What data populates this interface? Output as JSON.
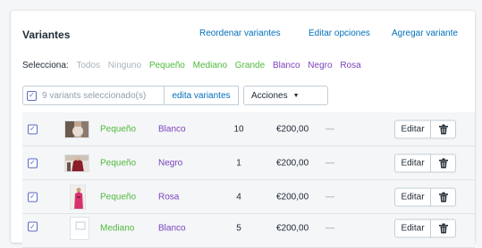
{
  "header": {
    "title": "Variantes",
    "reorder_link": "Reordenar variantes",
    "edit_options_link": "Editar opciones",
    "add_variant_link": "Agregar variante"
  },
  "select_filter": {
    "label": "Selecciona:",
    "options": [
      "Todos",
      "Ninguno",
      "Pequeño",
      "Mediano",
      "Grande",
      "Blanco",
      "Negro",
      "Rosa"
    ]
  },
  "bulk": {
    "selected_count": "9 variants seleccionado(s)",
    "edit_label": "edita variantes",
    "actions_label": "Acciones"
  },
  "variants": [
    {
      "size": "Pequeño",
      "color": "Blanco",
      "qty": "10",
      "price": "€200,00",
      "compare": "—",
      "checked": true,
      "edit_label": "Editar"
    },
    {
      "size": "Pequeño",
      "color": "Negro",
      "qty": "1",
      "price": "€200,00",
      "compare": "—",
      "checked": true,
      "edit_label": "Editar"
    },
    {
      "size": "Pequeño",
      "color": "Rosa",
      "qty": "4",
      "price": "€200,00",
      "compare": "—",
      "checked": true,
      "edit_label": "Editar"
    },
    {
      "size": "Mediano",
      "color": "Blanco",
      "qty": "5",
      "price": "€200,00",
      "compare": "—",
      "checked": true,
      "edit_label": "Editar"
    }
  ],
  "colors": {
    "link": "#006fbb",
    "size_text": "#50b83c",
    "color_text": "#7b42bc",
    "muted": "#aab2bb",
    "checkbox": "#5c6ac4"
  },
  "icons": {
    "checkbox": "check-icon",
    "delete": "trash-icon",
    "dropdown": "caret-down-icon"
  }
}
